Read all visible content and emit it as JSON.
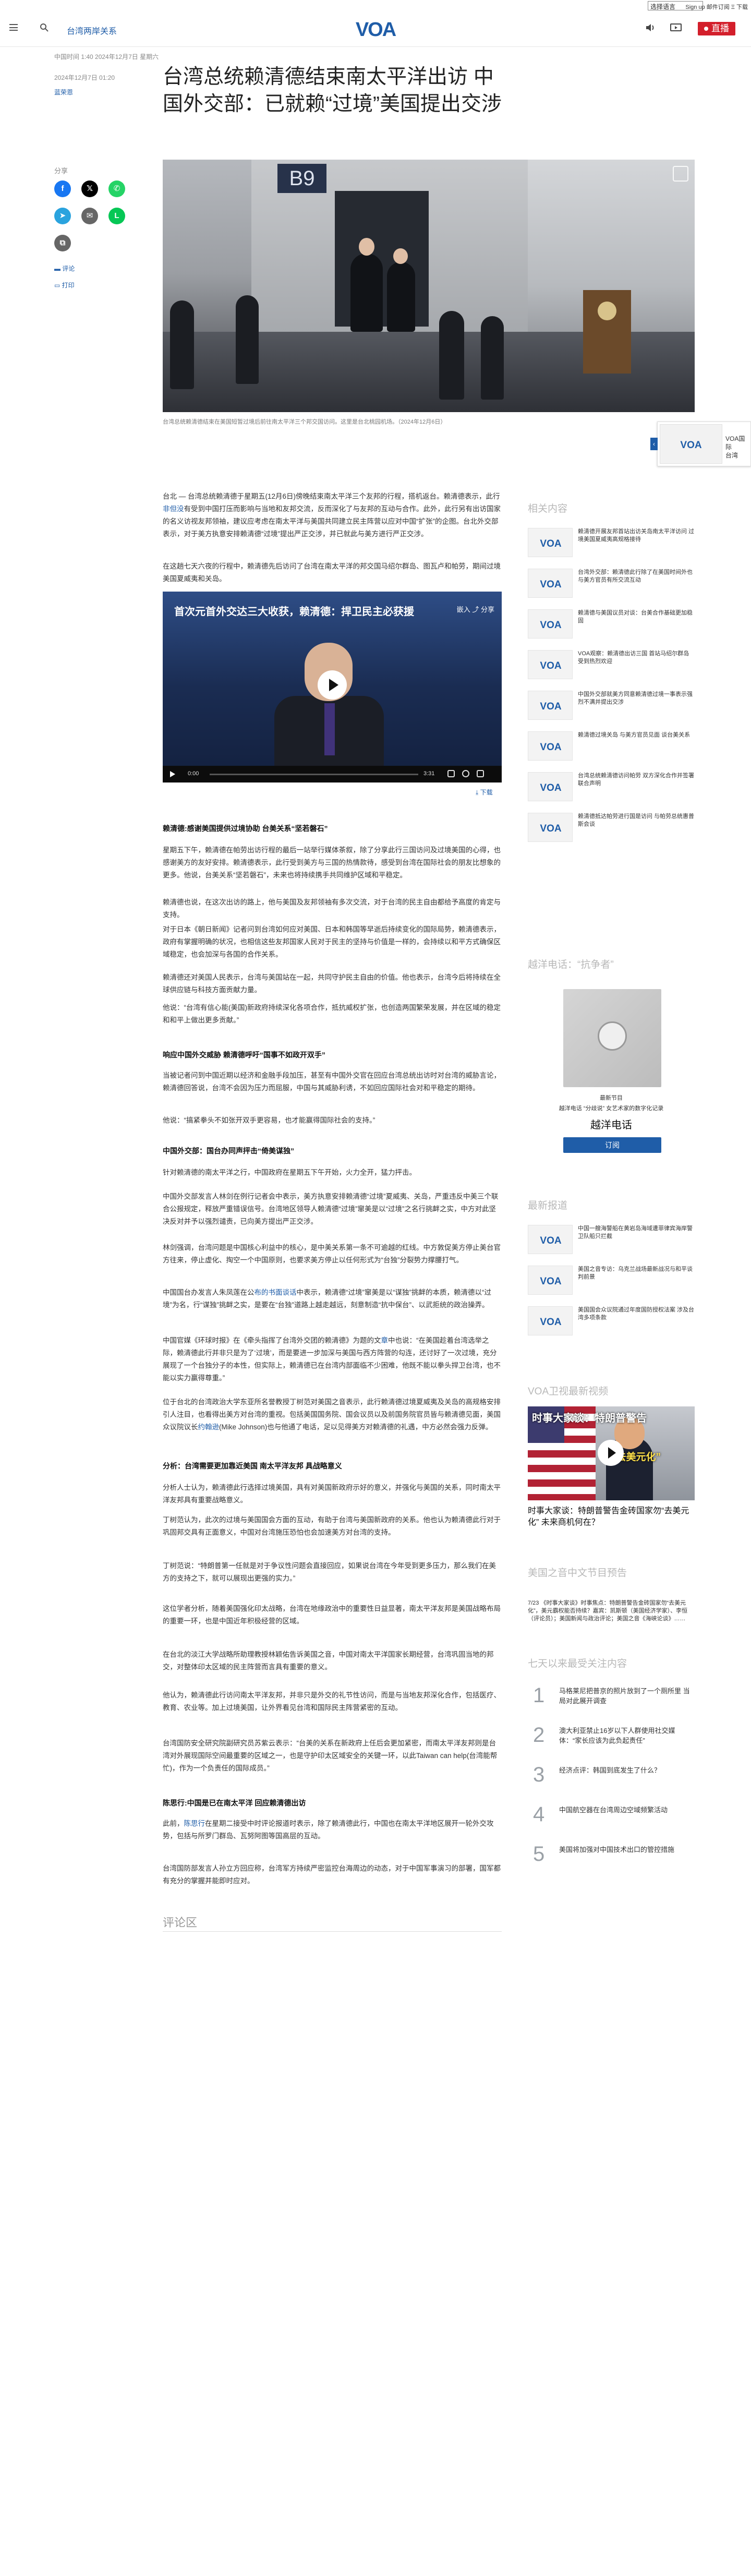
{
  "util": {
    "language_select": "选择语言",
    "links": "Sign up  邮件订阅  Ξ 下载"
  },
  "header": {
    "section": "台湾两岸关系",
    "logo": "VOA",
    "live": "直播"
  },
  "article": {
    "meta_top": "中国时间 1:40 2024年12月7日 星期六",
    "dateline": "2024年12月7日 01:20",
    "author": "蓝荣恩",
    "title": "台湾总统赖清德结束南太平洋出访 中国外交部：已就赖“过境”美国提出交涉",
    "share_label": "分享",
    "comment_label": "评论",
    "print_label": "打印",
    "photo_caption": "台湾总统赖清德结束在美国短暂过境后前往南太平洋三个邦交国访问。这里是台北桃园机场。（2024年12月6日）"
  },
  "floating": {
    "label": "VOA国际",
    "sub": "台湾",
    "logo": "VOA"
  },
  "video": {
    "title": "首次元首外交达三大收获，赖清德：捍卫民主必获援",
    "controls": "嵌入  ⤴ 分享",
    "time": "0:00",
    "duration": "3:31",
    "download": "下载"
  },
  "body": {
    "p1_a": "台北 — 台湾总统赖清德于星期五(12月6日)傍晚结束南太平洋三个友邦的行程，搭机返台。赖清德表示，此行",
    "p1_link": "非但没",
    "p1_b": "有受到中国打压而影响与当地和友邦交流，反而深化了与友邦的互动与合作。此外，此行另有出访国家的名义访视友邦领袖，建议应考虑在南太平洋与美国共同建立民主阵营以应对中国“扩张”的企图。台北外交部表示，对于美方执意安排赖清德“过境”提出严正交涉，并已就此与美方进行严正交涉。",
    "p2": "在这趟七天六夜的行程中，赖清德先后访问了台湾在南太平洋的邦交国马绍尔群岛、图瓦卢和帕劳，期间过境美国夏威夷和关岛。",
    "h1": "赖清德:感谢美国提供过境协助 台美关系“坚若磐石”",
    "p3": "星期五下午，赖清德在帕劳出访行程的最后一站举行媒体茶叙，除了分享此行三国访问及过境美国的心得，也感谢美方的友好安排。赖清德表示，此行受到美方与三国的热情款待，感受到台湾在国际社会的朋友比想象的更多。他说，台美关系“坚若磐石”，未来也将持续携手共同维护区域和平稳定。",
    "p4": "赖清德也说，在这次出访的路上，他与美国及友邦领袖有多次交流，对于台湾的民主自由都给予高度的肯定与支持。",
    "p5": "对于日本《朝日新闻》记者问到台湾如何应对美国、日本和韩国等早逝后持续变化的国际局势，赖清德表示，政府有掌握明确的状况，也相信这些友邦国家人民对于民主的坚持与价值是一样的，会持续以和平方式确保区域稳定，也会加深与各国的合作关系。",
    "p6": "赖清德还对美国人民表示，台湾与美国站在一起，共同守护民主自由的价值。他也表示，台湾今后将持续在全球供应链与科技方面贡献力量。",
    "p7": "他说：“台湾有信心能(美国)新政府持续深化各项合作，抵抗威权扩张，也创造两国繁荣发展，并在区域的稳定和和平上做出更多贡献。”",
    "h2": "响应中国外交威胁 赖清德呼吁“国事不如政开双手”",
    "p8": "当被记者问到中国近期以经济和金融手段加压，甚至有中国外交官在回应台湾总统出访时对台湾的威胁言论，赖清德回答说，台湾不会因为压力而屈服，中国与其威胁利诱，不如回应国际社会对和平稳定的期待。",
    "p9": "他说：“搞紧拳头不如张开双手更容易，也才能赢得国际社会的支持。”",
    "h3": "中国外交部：国台办同声抨击“倚美谋独”",
    "p10": "针对赖清德的南太平洋之行，中国政府在星期五下午开始，火力全开，猛力抨击。",
    "p11": "中国外交部发言人林剑在例行记者会中表示，美方执意安排赖清德“过境”夏威夷、关岛，严重违反中美三个联合公报规定，释放严重错误信号。台湾地区领导人赖清德“过境”窜美是以“过境”之名行挑衅之实，中方对此坚决反对并予以强烈谴责，已向美方提出严正交涉。",
    "p12": "林剑强调，台湾问题是中国核心利益中的核心，是中美关系第一条不可逾越的红线。中方敦促美方停止美台官方往来，停止虚化、掏空一个中国原则，也要求美方停止以任何形式为“台独”分裂势力撑腰打气。",
    "p13_a": "中国国台办发言人朱凤莲在公",
    "p13_link": "布的书面谈话",
    "p13_b": "中表示，赖清德“过境”窜美是以“谋独”挑衅的本质，赖清德以“过境”为名，行“谋独”挑衅之实，是要在“台独”道路上越走越远，刻意制造“抗中保台”、以武拒统的政治操弄。",
    "p14_a": "中国官媒《环球时报》在《牵头指挥了台湾外交团的赖清德》为题的文",
    "p14_link": "章",
    "p14_b": "中也说：“在美国趁着台湾选举之际，赖清德此行并非只是为了‘过境’，而是要进一步加深与美国与西方阵营的勾连，还讨好了一次过境，充分展现了一个台独分子的本性，但实际上，赖清德已在台湾内部面临不少困难，他既不能以拳头捍卫台湾，也不能以实力赢得尊重。”",
    "p15_a": "位于台北的台湾政治大学东亚所名誉教授丁树范对美国之音表示，此行赖清德过境夏威夷及关岛的高规格安排引人注目，也看得出美方对台湾的重视。包括美国国务院、国会议员以及前国务院官员皆与赖清德见面，美国众议院议长",
    "p15_link": "约翰逊",
    "p15_b": "(Mike Johnson)也与他通了电话，足以见得美方对赖清德的礼遇，中方必然会强力反弹。",
    "h4": "分析：台湾需要更加靠近美国 南太平洋友邦 具战略意义",
    "p16": "分析人士认为，赖清德此行选择过境美国，具有对美国新政府示好的意义，并强化与美国的关系，同时南太平洋友邦具有重要战略意义。",
    "p17": "丁树范认为，此次的过境与美国国会方面的互动，有助于台湾与美国新政府的关系。他也认为赖清德此行对于巩固邦交具有正面意义，中国对台湾施压恐怕也会加速美方对台湾的支持。",
    "p18": "丁树范说：“特朗普第一任就是对于争议性问题会直接回应，如果说台湾在今年受到更多压力，那么我们在美方的支持之下，就可以展现出更强的实力。”",
    "p19": "这位学者分析，随着美国强化印太战略，台湾在地缘政治中的重要性日益显著，南太平洋友邦是美国战略布局的重要一环，也是中国近年积极经营的区域。",
    "p20": "在台北的淡江大学战略所助理教授林颖佑告诉美国之音，中国对南太平洋国家长期经营，台湾巩固当地的邦交，对整体印太区域的民主阵营而言具有重要的意义。",
    "p21": "他认为，赖清德此行访问南太平洋友邦，并非只是外交的礼节性访问，而是与当地友邦深化合作，包括医疗、教育、农业等。加上过境美国，让外界看见台湾和国际民主阵营紧密的互动。",
    "p22": "台湾国防安全研究院副研究员苏紫云表示：“台美的关系在新政府上任后会更加紧密，而南太平洋友邦则是台湾对外展现国际空间最重要的区域之一，也是守护印太区域安全的关键一环，以此Taiwan can help(台湾能帮忙)，作为一个负责任的国际成员。”",
    "h5": "陈思行:中国是已在南太平洋 回应赖清德出访",
    "p23_a": "此前，",
    "p23_link": "陈思行",
    "p23_b": "在星期二接受中时评论报道时表示，除了赖清德此行，中国也在南太平洋地区展开一轮外交攻势，包括与所罗门群岛、瓦努阿图等国高层的互动。",
    "p24": "台湾国防部发言人孙立方回应称，台湾军方持续严密监控台海周边的动态，对于中国军事演习的部署，国军都有充分的掌握并能即时应对。"
  },
  "comments_label": "评论区",
  "rail": {
    "related_title": "相关内容",
    "related": [
      "赖清德开展友邦首站出访关岛南太平洋访问 过境美国夏威夷高规格接待",
      "台湾外交部：赖清德此行除了在美国时间外也与美方官员有所交流互动",
      "赖清德与美国议员对谈：台美合作基础更加稳固",
      "VOA观察：赖清德出访三国 首站马绍尔群岛受到热烈欢迎",
      "中国外交部就美方同意赖清德过境一事表示强烈不满并提出交涉",
      "赖清德过境关岛 与美方官员见面 谈台美关系",
      "台湾总统赖清德访问帕劳 双方深化合作并签署联合声明",
      "赖清德抵达帕劳进行国是访问 与帕劳总统惠普斯会谈"
    ],
    "podcast_section": "越洋电话：“抗争者”",
    "podcast_latest": "最新节目",
    "podcast_desc": "越洋电话 “分歧说” 女艺术家的数字化记录",
    "podcast_title": "越洋电话",
    "subscribe": "订阅",
    "latest_title": "最新报道",
    "latest": [
      "中国一艘海警船在黄岩岛海域遭菲律宾海岸警卫队船只拦截",
      "美国之音专访：乌克兰战场最新战况与和平谈判前景",
      "美国国会众议院通过年度国防授权法案 涉及台湾多项条款"
    ],
    "video_section": "VOA卫视最新视频",
    "video_cap1": "时事大家谈：特朗普警告",
    "video_cap2": "“去美元化”",
    "video_title": "时事大家谈：特朗普警告金砖国家勿“去美元化” 未来商机何在？",
    "program_title": "美国之音中文节目预告",
    "program_text": "7/23 《时事大家谈》时事焦点：特朗普警告金砖国家勿“去美元化”，美元霸权能否持续？嘉宾：凯斯顿（美国经济学家）、李恒（评论员）；美国新闻与政治评论；美国之音《海峡论谈》……",
    "top_title": "七天以来最受关注内容",
    "top": [
      "马格莱尼把普京的照片放到了一个厕所里 当局对此展开调查",
      "澳大利亚禁止16岁以下人群使用社交媒体：“家长应该为此负起责任”",
      "经济点评：韩国到底发生了什么？",
      "中国航空器在台湾周边空域频繁活动",
      "美国将加强对中国技术出口的管控措施"
    ]
  },
  "colors": {
    "brand": "#1f5da8",
    "live": "#d31f2b"
  }
}
